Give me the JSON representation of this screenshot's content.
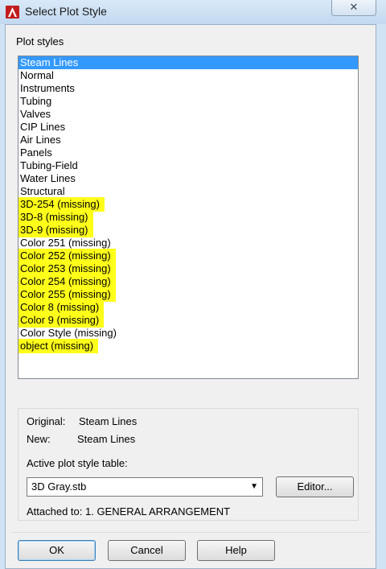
{
  "window": {
    "title": "Select Plot Style",
    "close_glyph": "✕"
  },
  "plot_styles": {
    "label": "Plot styles",
    "selected_index": 0,
    "items": [
      {
        "label": "Steam Lines",
        "highlight": false
      },
      {
        "label": "Normal",
        "highlight": false
      },
      {
        "label": "Instruments",
        "highlight": false
      },
      {
        "label": "Tubing",
        "highlight": false
      },
      {
        "label": "Valves",
        "highlight": false
      },
      {
        "label": "CIP Lines",
        "highlight": false
      },
      {
        "label": "Air Lines",
        "highlight": false
      },
      {
        "label": "Panels",
        "highlight": false
      },
      {
        "label": "Tubing-Field",
        "highlight": false
      },
      {
        "label": "Water Lines",
        "highlight": false
      },
      {
        "label": "Structural",
        "highlight": false
      },
      {
        "label": "3D-254 (missing)",
        "highlight": true
      },
      {
        "label": "3D-8 (missing)",
        "highlight": true
      },
      {
        "label": "3D-9 (missing)",
        "highlight": true
      },
      {
        "label": "Color 251 (missing)",
        "highlight": false
      },
      {
        "label": "Color 252 (missing)",
        "highlight": true
      },
      {
        "label": "Color 253 (missing)",
        "highlight": true
      },
      {
        "label": "Color 254 (missing)",
        "highlight": true
      },
      {
        "label": "Color 255 (missing)",
        "highlight": true
      },
      {
        "label": "Color 8 (missing)",
        "highlight": true
      },
      {
        "label": "Color 9 (missing)",
        "highlight": true
      },
      {
        "label": "Color Style (missing)",
        "highlight": false
      },
      {
        "label": "object (missing)",
        "highlight": true
      }
    ]
  },
  "info": {
    "original_label": "Original:",
    "original_value": "Steam Lines",
    "new_label": "New:",
    "new_value": "Steam Lines",
    "active_table_label": "Active plot style table:",
    "active_table_value": "3D Gray.stb",
    "editor_button": "Editor...",
    "attached_to": "Attached to: 1. GENERAL ARRANGEMENT"
  },
  "buttons": {
    "ok": "OK",
    "cancel": "Cancel",
    "help": "Help"
  },
  "colors": {
    "selection": "#3399ff",
    "highlighter": "#ffff1a",
    "title_gradient": "#c2d9f0"
  }
}
